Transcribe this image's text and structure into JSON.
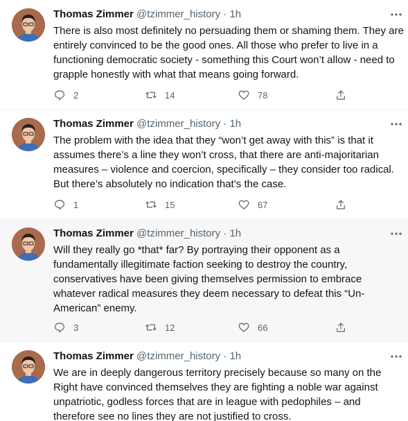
{
  "tweets": [
    {
      "name": "Thomas Zimmer",
      "handle": "@tzimmer_history",
      "dot": "·",
      "time": "1h",
      "lines": [
        "There is also most definitely no persuading them or shaming them. They are",
        "entirely convinced to be the good ones. All those who prefer to live in a",
        "functioning democratic society - something this Court won’t allow - need to",
        "grapple honestly with what that means going forward."
      ],
      "replies": "2",
      "retweets": "14",
      "likes": "78"
    },
    {
      "name": "Thomas Zimmer",
      "handle": "@tzimmer_history",
      "dot": "·",
      "time": "1h",
      "lines": [
        "The problem with the idea that they “won’t get away with this” is that it",
        "assumes there’s a line they won’t cross, that there are anti-majoritarian",
        "measures – violence and coercion, specifically – they consider too radical.",
        "But there’s absolutely no indication that’s the case."
      ],
      "replies": "1",
      "retweets": "15",
      "likes": "67"
    },
    {
      "name": "Thomas Zimmer",
      "handle": "@tzimmer_history",
      "dot": "·",
      "time": "1h",
      "lines": [
        "Will they really go *that* far? By portraying their opponent as a",
        "fundamentally illegitimate faction seeking to destroy the country,",
        "conservatives have been giving themselves permission to embrace",
        "whatever radical measures they deem necessary to defeat this “Un-",
        "American” enemy."
      ],
      "replies": "3",
      "retweets": "12",
      "likes": "66"
    },
    {
      "name": "Thomas Zimmer",
      "handle": "@tzimmer_history",
      "dot": "·",
      "time": "1h",
      "lines": [
        "We are in deeply dangerous territory precisely because so many on the",
        "Right have convinced themselves they are fighting a noble war against",
        "unpatriotic, godless forces that are in league with pedophiles – and",
        "therefore see no lines they are not justified to cross."
      ]
    }
  ],
  "icons": {
    "reply": "reply-icon",
    "retweet": "retweet-icon",
    "like": "heart-icon",
    "share": "share-icon",
    "more": "more-dots-icon"
  },
  "colors": {
    "secondary_text": "#536471",
    "highlight_bg": "#f7f7f7"
  }
}
